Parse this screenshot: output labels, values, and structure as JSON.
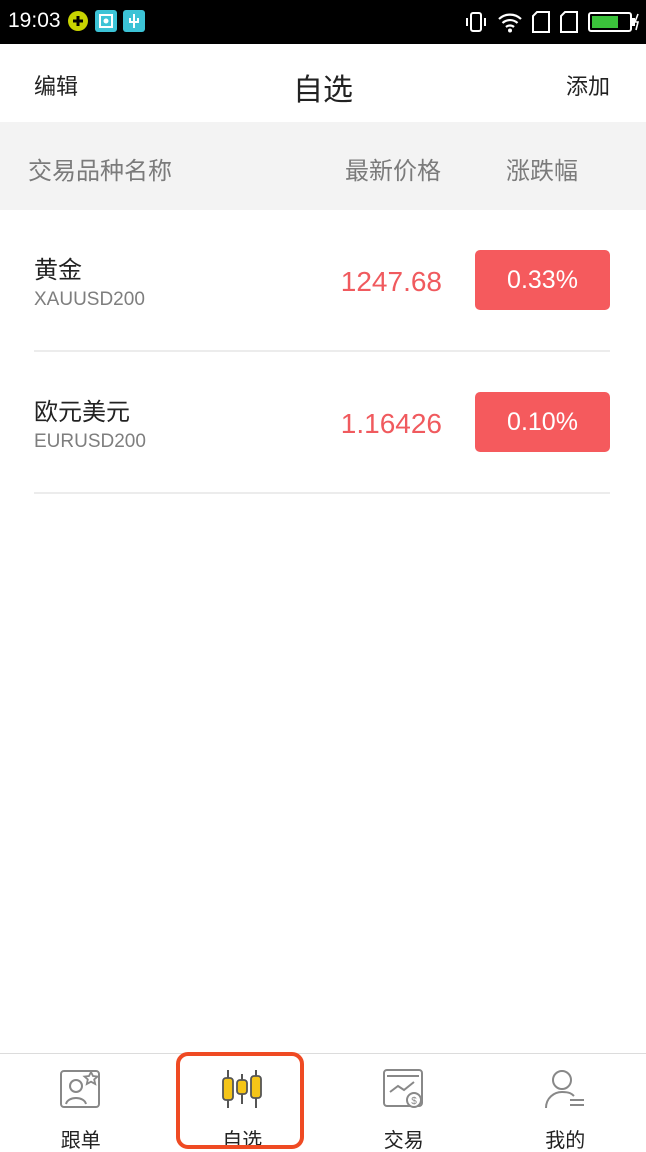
{
  "status_bar": {
    "time": "19:03"
  },
  "header": {
    "edit_label": "编辑",
    "title": "自选",
    "add_label": "添加"
  },
  "columns": {
    "name": "交易品种名称",
    "price": "最新价格",
    "change": "涨跌幅"
  },
  "rows": [
    {
      "name": "黄金",
      "code": "XAUUSD200",
      "price": "1247.68",
      "change": "0.33%"
    },
    {
      "name": "欧元美元",
      "code": "EURUSD200",
      "price": "1.16426",
      "change": "0.10%"
    }
  ],
  "bottom_nav": [
    {
      "label": "跟单",
      "icon": "follow-icon"
    },
    {
      "label": "自选",
      "icon": "candlestick-icon"
    },
    {
      "label": "交易",
      "icon": "trade-icon"
    },
    {
      "label": "我的",
      "icon": "profile-icon"
    }
  ],
  "colors": {
    "accent_red": "#f55a5d",
    "highlight_border": "#ef4a23",
    "candle_yellow": "#f5c518"
  }
}
